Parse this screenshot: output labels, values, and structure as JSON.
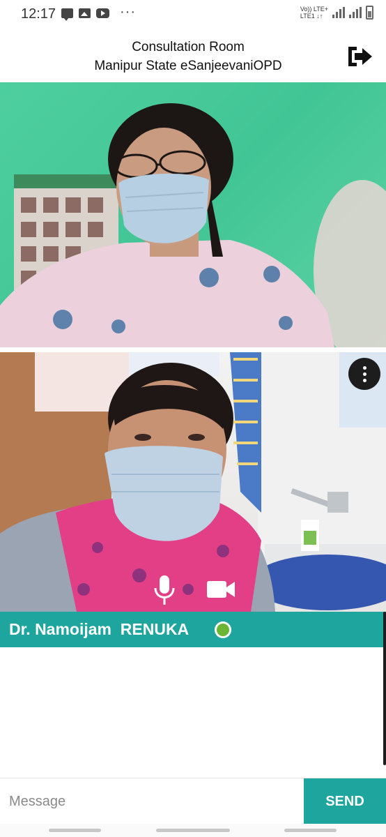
{
  "status_bar": {
    "time": "12:17",
    "more": "···",
    "network_line1": "Vo)) LTE+",
    "network_line2": "LTE1 ↓↑",
    "icons": [
      "message-icon",
      "image-icon",
      "youtube-icon",
      "signal-icon",
      "battery-icon"
    ]
  },
  "header": {
    "title": "Consultation Room",
    "subtitle": "Manipur State eSanjeevaniOPD",
    "exit_icon": "exit-icon"
  },
  "video": {
    "controls": [
      "mic-icon",
      "video-camera-icon",
      "more-vert-icon"
    ]
  },
  "participant": {
    "name": "Dr. Namoijam  RENUKA",
    "status_color": "#6ab535"
  },
  "composer": {
    "placeholder": "Message",
    "send_label": "SEND"
  },
  "colors": {
    "accent": "#1ea59d"
  }
}
